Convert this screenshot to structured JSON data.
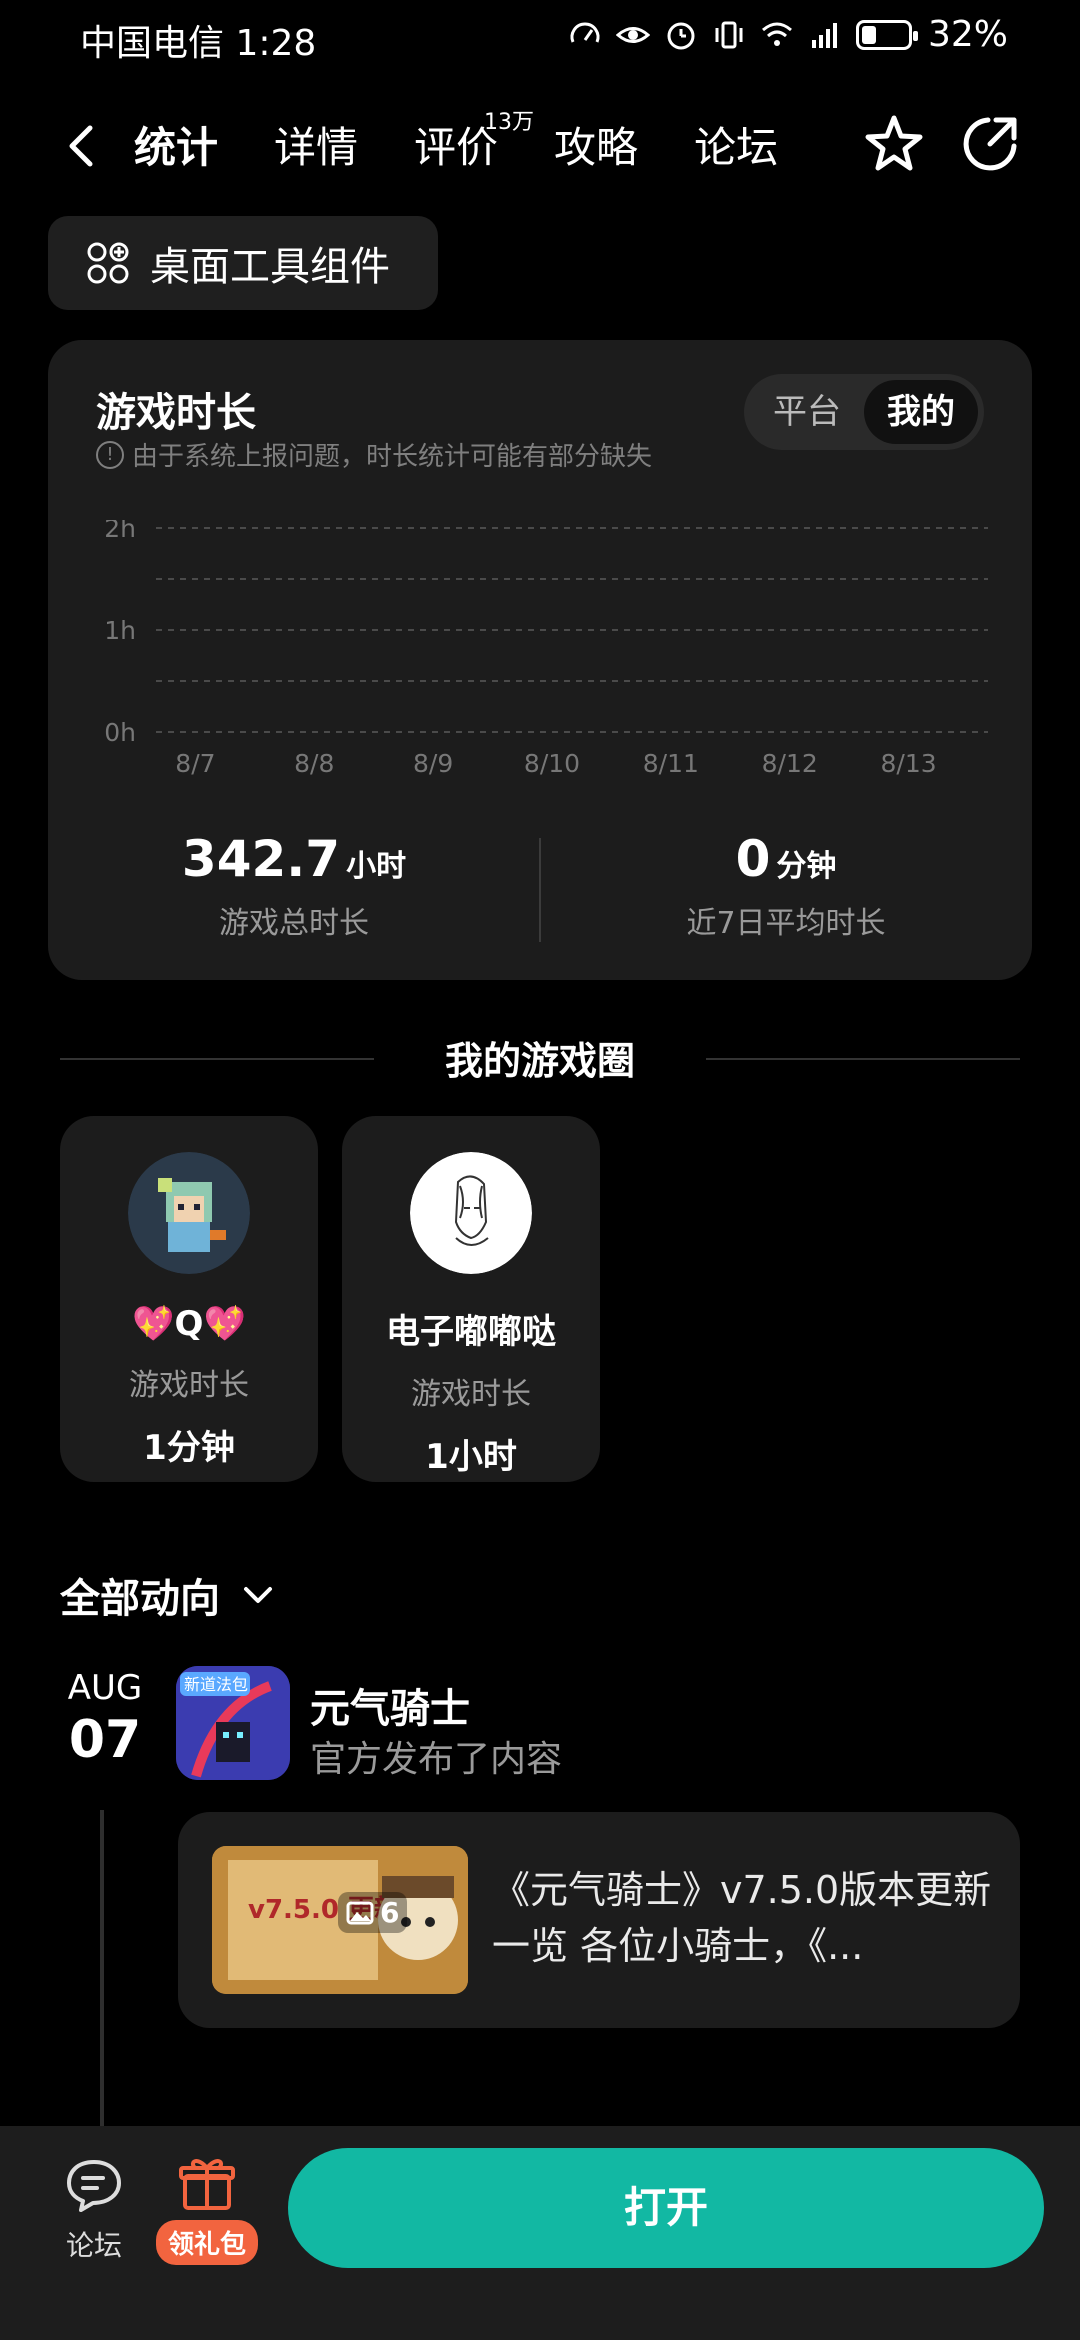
{
  "status_bar": {
    "carrier_time": "中国电信 1:28",
    "battery": "32%",
    "battery_level": 0.32,
    "network": "4G"
  },
  "nav": {
    "tabs": [
      {
        "label": "统计",
        "active": true
      },
      {
        "label": "详情"
      },
      {
        "label": "评价",
        "badge": "13万"
      },
      {
        "label": "攻略"
      },
      {
        "label": "论坛"
      }
    ]
  },
  "widget_chip": {
    "label": "桌面工具组件"
  },
  "playtime_card": {
    "title": "游戏时长",
    "note": "由于系统上报问题，时长统计可能有部分缺失",
    "toggle": {
      "option_a": "平台",
      "option_b": "我的",
      "selected": "我的"
    },
    "total": {
      "value": "342.7",
      "unit": "小时",
      "label": "游戏总时长"
    },
    "avg": {
      "value": "0",
      "unit": "分钟",
      "label": "近7日平均时长"
    }
  },
  "chart_data": {
    "type": "bar",
    "categories": [
      "8/7",
      "8/8",
      "8/9",
      "8/10",
      "8/11",
      "8/12",
      "8/13"
    ],
    "values": [
      0,
      0,
      0,
      0,
      0,
      0,
      0
    ],
    "yticks": [
      "2h",
      "1h",
      "0h"
    ],
    "ylim": [
      0,
      2
    ],
    "grid": true
  },
  "game_circle": {
    "title": "我的游戏圈",
    "friends": [
      {
        "name": "💖Q💖",
        "label": "游戏时长",
        "value": "1分钟"
      },
      {
        "name": "电子嘟嘟哒",
        "label": "游戏时长",
        "value": "1小时"
      }
    ]
  },
  "feed": {
    "filter_label": "全部动向",
    "entries": [
      {
        "month": "AUG",
        "day": "07",
        "game": "元气骑士",
        "action": "官方发布了内容",
        "post_text": "《元气骑士》v7.5.0版本更新一览 各位小骑士，《...",
        "image_count": "6",
        "thumb_caption": "v7.5.0 更新一览",
        "icon_label": "新道法包"
      }
    ]
  },
  "bottom_bar": {
    "forum_label": "论坛",
    "gift_label": "领礼包",
    "open_label": "打开"
  },
  "colors": {
    "accent": "#12b8a3",
    "gift": "#f2643f",
    "card_bg": "#1c1c1c"
  }
}
